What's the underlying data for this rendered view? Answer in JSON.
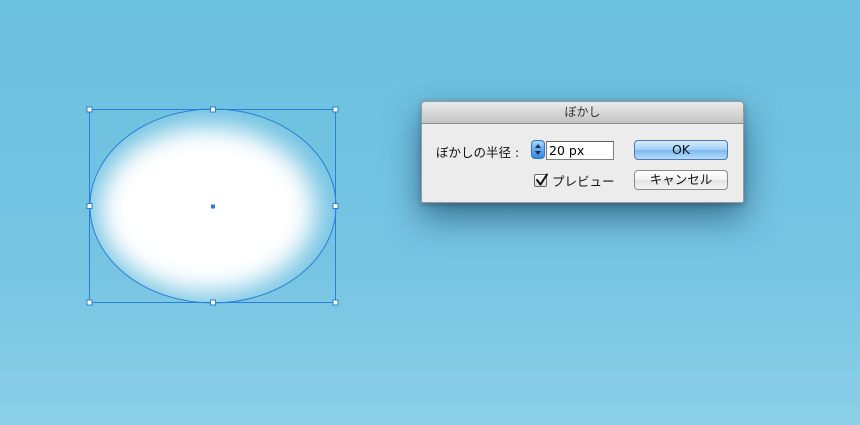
{
  "dialog": {
    "title": "ぼかし",
    "radius_label": "ぼかしの半径 :",
    "radius_value": "20 px",
    "preview_label": "プレビュー",
    "preview_checked": true,
    "ok_label": "OK",
    "cancel_label": "キャンセル"
  },
  "icons": {
    "stepper": "up-down-stepper-icon",
    "checkbox": "checkmark-icon"
  },
  "colors": {
    "background": "#75c4e2",
    "selection": "#2a7fd8",
    "ok_button": "#a3cff5"
  }
}
